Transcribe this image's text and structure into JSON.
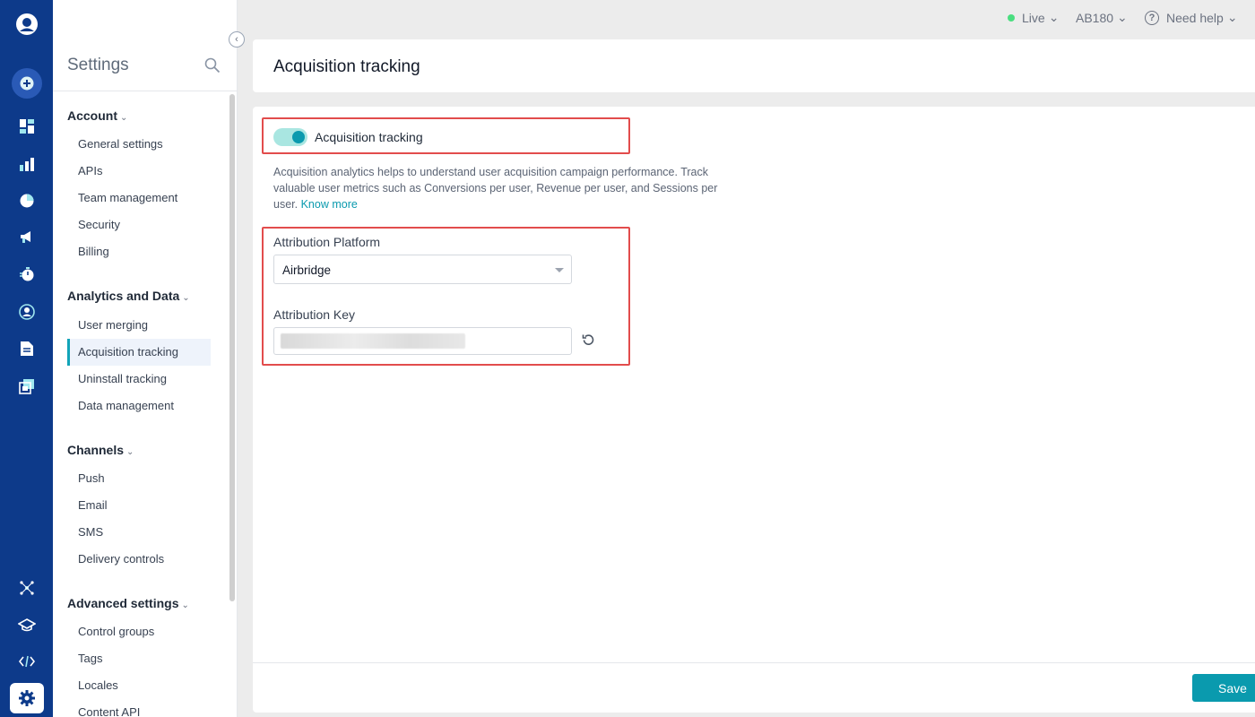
{
  "rail": {
    "icons": [
      "user-logo-icon",
      "create-plus-icon",
      "dashboard-icon",
      "analytics-icon",
      "pie-chart-icon",
      "megaphone-icon",
      "timer-icon",
      "user-circle-icon",
      "document-icon",
      "gallery-icon",
      "integrations-icon",
      "academy-icon",
      "code-icon",
      "settings-gear-icon"
    ]
  },
  "sidebar": {
    "title": "Settings",
    "groups": [
      {
        "label": "Account",
        "items": [
          "General settings",
          "APIs",
          "Team management",
          "Security",
          "Billing"
        ]
      },
      {
        "label": "Analytics and Data",
        "items": [
          "User merging",
          "Acquisition tracking",
          "Uninstall tracking",
          "Data management"
        ]
      },
      {
        "label": "Channels",
        "items": [
          "Push",
          "Email",
          "SMS",
          "Delivery controls"
        ]
      },
      {
        "label": "Advanced settings",
        "items": [
          "Control groups",
          "Tags",
          "Locales",
          "Content API"
        ]
      }
    ],
    "active_item": "Acquisition tracking"
  },
  "topbar": {
    "status": "Live",
    "workspace": "AB180",
    "help": "Need help"
  },
  "page": {
    "title": "Acquisition tracking",
    "toggle_label": "Acquisition tracking",
    "toggle_on": true,
    "description": "Acquisition analytics helps to understand user acquisition campaign performance. Track valuable user metrics such as Conversions per user, Revenue per user, and Sessions per user.",
    "know_more": "Know more",
    "platform_label": "Attribution Platform",
    "platform_value": "Airbridge",
    "key_label": "Attribution Key",
    "save_label": "Save"
  },
  "colors": {
    "rail": "#0d3a8a",
    "accent": "#0a9aae",
    "highlight_box": "#e24c4c"
  }
}
